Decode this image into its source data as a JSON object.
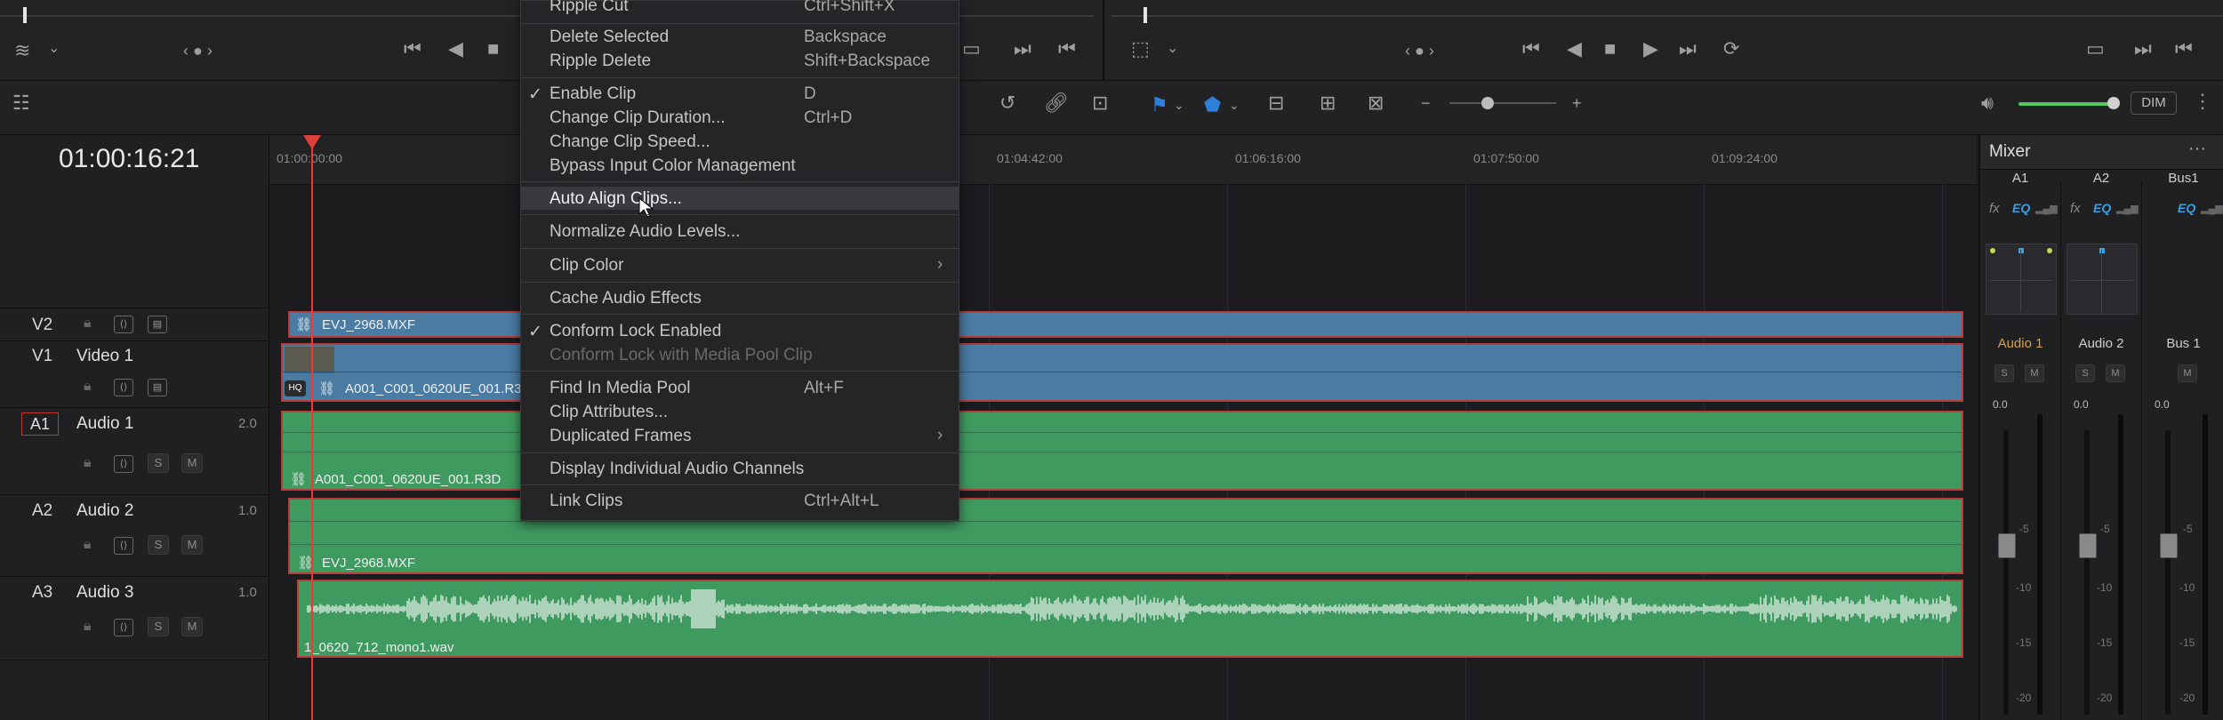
{
  "timecode": "01:00:16:21",
  "ruler_ticks": [
    "01:00:00:00",
    "01:04:42:00",
    "01:06:16:00",
    "01:07:50:00",
    "01:09:24:00"
  ],
  "context_menu": {
    "items": [
      {
        "label": "Ripple Cut",
        "shortcut": "Ctrl+Shift+X",
        "disabled": false
      },
      {
        "label": "Delete Selected",
        "shortcut": "Backspace"
      },
      {
        "label": "Ripple Delete",
        "shortcut": "Shift+Backspace"
      },
      {
        "label": "Enable Clip",
        "shortcut": "D",
        "checked": true
      },
      {
        "label": "Change Clip Duration...",
        "shortcut": "Ctrl+D"
      },
      {
        "label": "Change Clip Speed...",
        "shortcut": ""
      },
      {
        "label": "Bypass Input Color Management",
        "shortcut": ""
      },
      {
        "label": "Auto Align Clips...",
        "shortcut": "",
        "highlighted": true
      },
      {
        "label": "Normalize Audio Levels...",
        "shortcut": ""
      },
      {
        "label": "Clip Color",
        "shortcut": "",
        "submenu": true
      },
      {
        "label": "Cache Audio Effects",
        "shortcut": ""
      },
      {
        "label": "Conform Lock Enabled",
        "shortcut": "",
        "checked": true
      },
      {
        "label": "Conform Lock with Media Pool Clip",
        "shortcut": "",
        "disabled": true
      },
      {
        "label": "Find In Media Pool",
        "shortcut": "Alt+F"
      },
      {
        "label": "Clip Attributes...",
        "shortcut": ""
      },
      {
        "label": "Duplicated Frames",
        "shortcut": "",
        "submenu": true
      },
      {
        "label": "Display Individual Audio Channels",
        "shortcut": ""
      },
      {
        "label": "Link Clips",
        "shortcut": "Ctrl+Alt+L"
      }
    ]
  },
  "tracks": {
    "v2": {
      "id": "V2",
      "clip": "EVJ_2968.MXF"
    },
    "v1": {
      "id": "V1",
      "name": "Video 1",
      "clip": "A001_C001_0620UE_001.R3D",
      "badge": "HQ"
    },
    "a1": {
      "id": "A1",
      "name": "Audio 1",
      "ch": "2.0",
      "clip": "A001_C001_0620UE_001.R3D",
      "s": "S",
      "m": "M"
    },
    "a2": {
      "id": "A2",
      "name": "Audio 2",
      "ch": "1.0",
      "clip": "EVJ_2968.MXF",
      "s": "S",
      "m": "M"
    },
    "a3": {
      "id": "A3",
      "name": "Audio 3",
      "ch": "1.0",
      "clip": "1_0620_712_mono1.wav",
      "s": "S",
      "m": "M"
    }
  },
  "toolbar": {
    "dim_label": "DIM"
  },
  "mixer": {
    "title": "Mixer",
    "columns": [
      {
        "head": "A1",
        "fx": "fx",
        "eq": "EQ",
        "name": "Audio 1",
        "s": "S",
        "m": "M",
        "level": "0.0",
        "name_color": "#d8a23a"
      },
      {
        "head": "A2",
        "fx": "fx",
        "eq": "EQ",
        "name": "Audio 2",
        "s": "S",
        "m": "M",
        "level": "0.0",
        "name_color": "#cfcfcf"
      },
      {
        "head": "Bus1",
        "fx": "",
        "eq": "EQ",
        "name": "Bus 1",
        "s": "",
        "m": "M",
        "level": "0.0",
        "name_color": "#cfcfcf"
      }
    ],
    "scale": [
      "-5",
      "-10",
      "-15",
      "-20"
    ]
  },
  "colors": {
    "accent_blue": "#2d7fd8",
    "playhead": "#e0403c",
    "video_clip": "#4a7ba3",
    "audio_clip": "#3f9a5f",
    "volume": "#4ec95a"
  }
}
